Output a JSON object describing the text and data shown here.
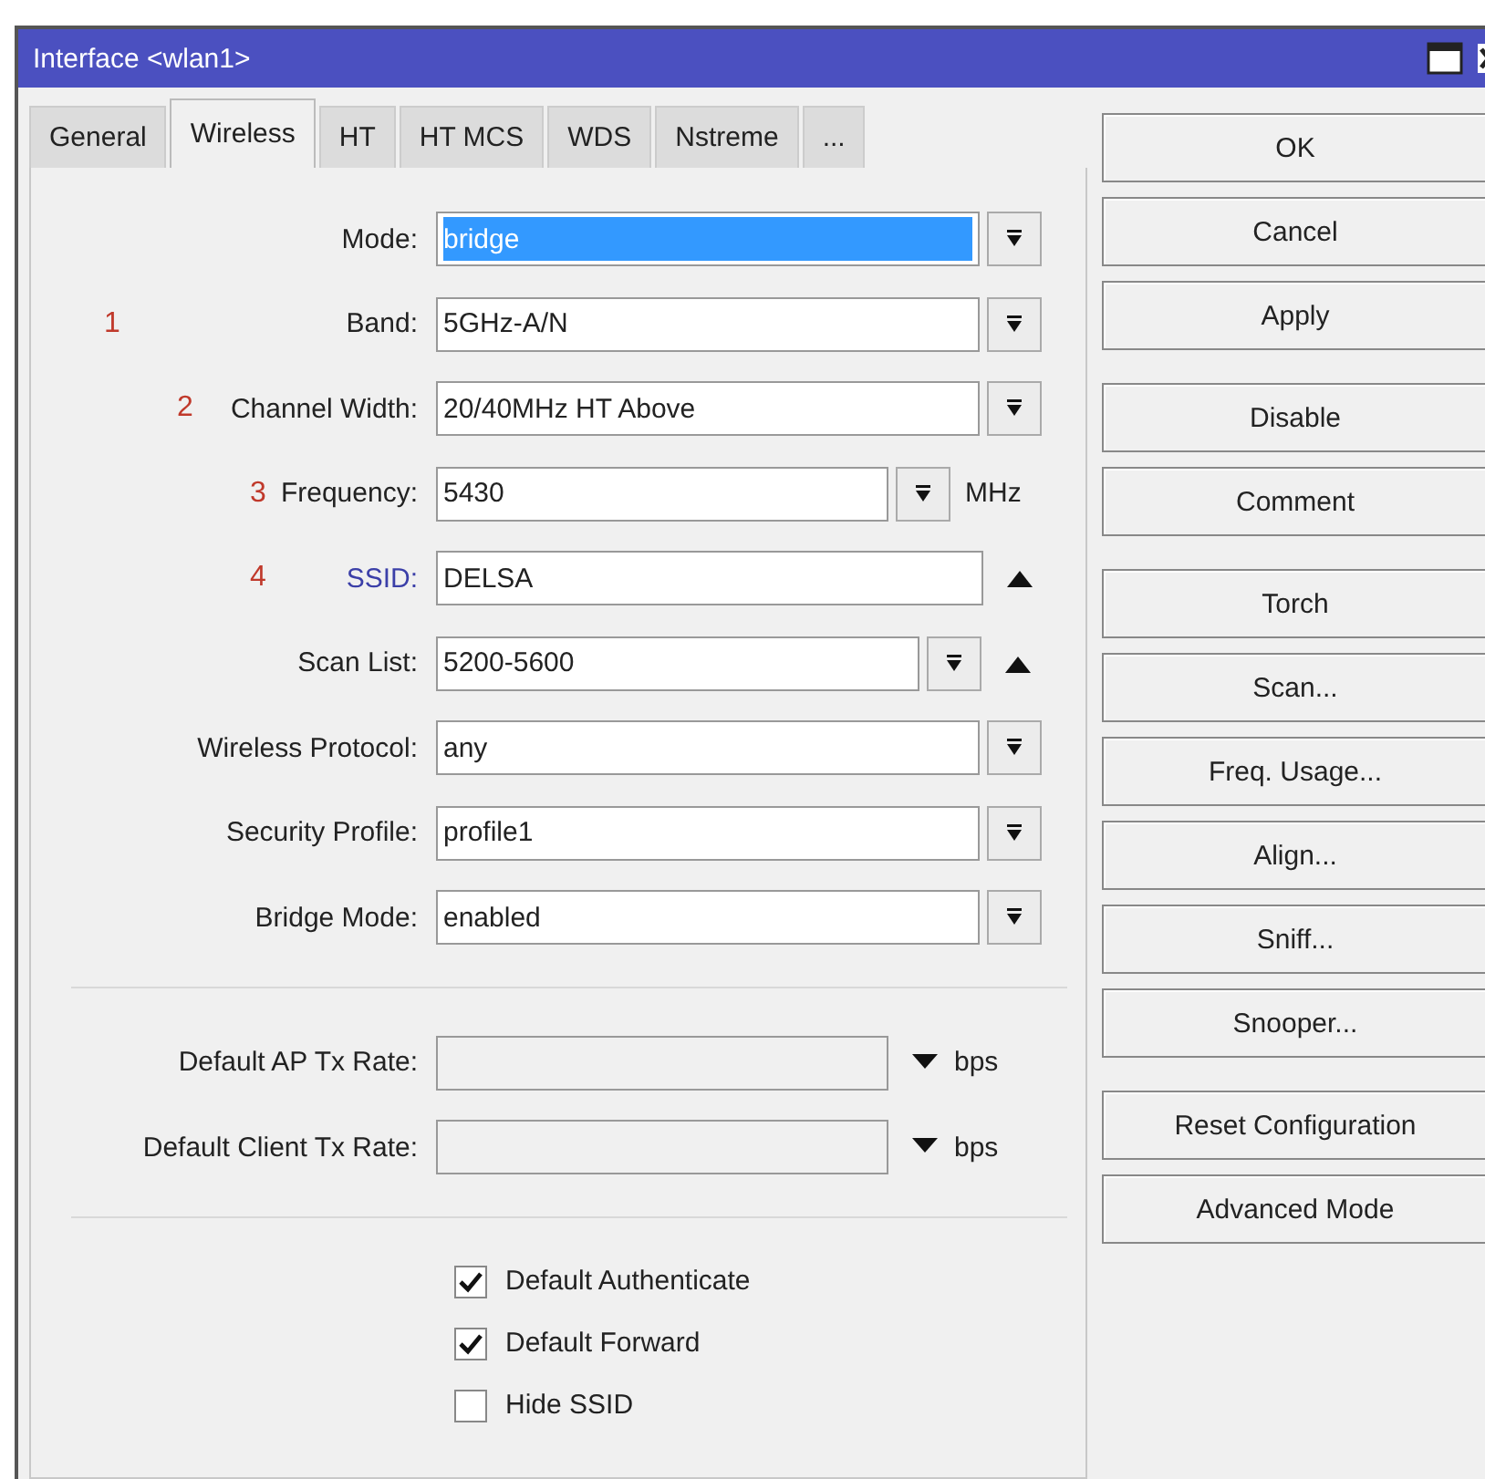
{
  "window": {
    "title": "Interface <wlan1>"
  },
  "tabs": [
    {
      "label": "General",
      "selected": false
    },
    {
      "label": "Wireless",
      "selected": true
    },
    {
      "label": "HT",
      "selected": false
    },
    {
      "label": "HT MCS",
      "selected": false
    },
    {
      "label": "WDS",
      "selected": false
    },
    {
      "label": "Nstreme",
      "selected": false
    },
    {
      "label": "...",
      "selected": false
    }
  ],
  "fields": [
    {
      "kind": "select",
      "label": "Mode:",
      "value": "bridge",
      "selected": true,
      "required": false
    },
    {
      "kind": "select",
      "label": "Band:",
      "value": "5GHz-A/N",
      "selected": false,
      "required": false,
      "marker": "1"
    },
    {
      "kind": "select",
      "label": "Channel Width:",
      "value": "20/40MHz HT Above",
      "selected": false,
      "required": false,
      "marker": "2"
    },
    {
      "kind": "select_unit",
      "label": "Frequency:",
      "value": "5430",
      "unit": "MHz",
      "selected": false,
      "required": false,
      "marker": "3"
    },
    {
      "kind": "text_toggle",
      "label": "SSID:",
      "value": "DELSA",
      "selected": false,
      "required": true,
      "marker": "4"
    },
    {
      "kind": "select_toggle",
      "label": "Scan List:",
      "value": "5200-5600",
      "selected": false,
      "required": false
    },
    {
      "kind": "select",
      "label": "Wireless Protocol:",
      "value": "any",
      "selected": false,
      "required": false
    },
    {
      "kind": "select",
      "label": "Security Profile:",
      "value": "profile1",
      "selected": false,
      "required": false
    },
    {
      "kind": "select",
      "label": "Bridge Mode:",
      "value": "enabled",
      "selected": false,
      "required": false
    }
  ],
  "rates": [
    {
      "label": "Default AP Tx Rate:",
      "unit": "bps"
    },
    {
      "label": "Default Client Tx Rate:",
      "unit": "bps"
    }
  ],
  "checkboxes": [
    {
      "label": "Default Authenticate",
      "checked": true
    },
    {
      "label": "Default Forward",
      "checked": true
    },
    {
      "label": "Hide SSID",
      "checked": false
    }
  ],
  "button_groups": [
    {
      "buttons": [
        "OK",
        "Cancel",
        "Apply"
      ]
    },
    {
      "buttons": [
        "Disable",
        "Comment"
      ]
    },
    {
      "buttons": [
        "Torch",
        "Scan...",
        "Freq. Usage...",
        "Align...",
        "Sniff...",
        "Snooper..."
      ]
    },
    {
      "buttons": [
        "Reset Configuration",
        "Advanced Mode"
      ]
    }
  ]
}
